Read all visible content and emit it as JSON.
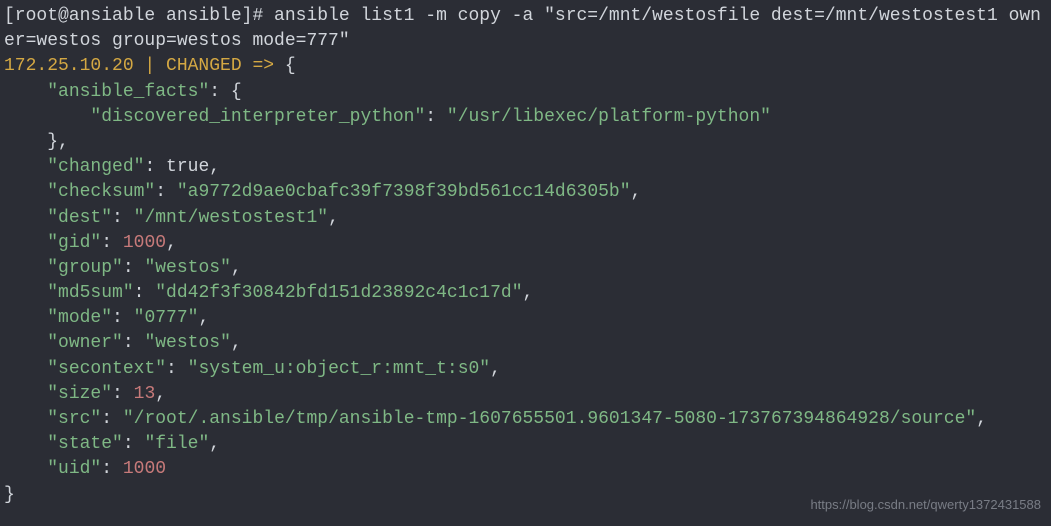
{
  "prompt": {
    "full": "[root@ansiable ansible]# ",
    "command": "ansible list1 -m copy -a \"src=/mnt/westosfile dest=/mnt/westostest1 owner=westos group=westos mode=777\""
  },
  "result": {
    "host": "172.25.10.20",
    "status": "CHANGED",
    "arrow": "=>"
  },
  "json": {
    "ansible_facts_key": "\"ansible_facts\"",
    "discovered_key": "\"discovered_interpreter_python\"",
    "discovered_val": "\"/usr/libexec/platform-python\"",
    "changed_key": "\"changed\"",
    "changed_val": "true",
    "checksum_key": "\"checksum\"",
    "checksum_val": "\"a9772d9ae0cbafc39f7398f39bd561cc14d6305b\"",
    "dest_key": "\"dest\"",
    "dest_val": "\"/mnt/westostest1\"",
    "gid_key": "\"gid\"",
    "gid_val": "1000",
    "group_key": "\"group\"",
    "group_val": "\"westos\"",
    "md5sum_key": "\"md5sum\"",
    "md5sum_val": "\"dd42f3f30842bfd151d23892c4c1c17d\"",
    "mode_key": "\"mode\"",
    "mode_val": "\"0777\"",
    "owner_key": "\"owner\"",
    "owner_val": "\"westos\"",
    "secontext_key": "\"secontext\"",
    "secontext_val": "\"system_u:object_r:mnt_t:s0\"",
    "size_key": "\"size\"",
    "size_val": "13",
    "src_key": "\"src\"",
    "src_val": "\"/root/.ansible/tmp/ansible-tmp-1607655501.9601347-5080-173767394864928/source\"",
    "state_key": "\"state\"",
    "state_val": "\"file\"",
    "uid_key": "\"uid\"",
    "uid_val": "1000"
  },
  "watermark": "https://blog.csdn.net/qwerty1372431588"
}
